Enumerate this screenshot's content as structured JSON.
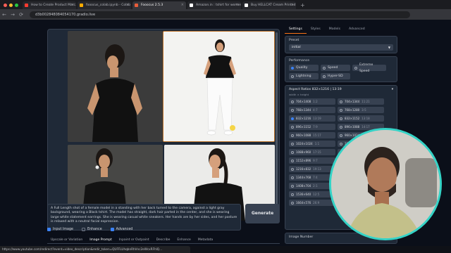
{
  "browser": {
    "tabs": [
      {
        "label": "How to Create Product Marc...",
        "color": "#ff3b30",
        "active": false
      },
      {
        "label": "fooocus_colab.ipynb - Colab",
        "color": "#f9ab00",
        "active": false
      },
      {
        "label": "Fooocus 2.5.3",
        "color": "#e85d3a",
        "active": true
      },
      {
        "label": "Amazon.in : tshirt for women",
        "color": "#ffffff",
        "active": false
      },
      {
        "label": "Buy HELLCAT Cream Printed...",
        "color": "#ffffff",
        "active": false
      }
    ],
    "new_tab": "+",
    "url": "d3b002848084054170.gradio.live",
    "nav": {
      "back": "←",
      "forward": "→",
      "reload": "⟳"
    }
  },
  "prompt": {
    "text": "A Full Length shot of a female model in a standing with her back turned to the camera, against a light gray background, wearing a Black tshirt. The model has straight, dark hair parted in the center, and she is wearing large white statement earrings. She is wearing casual white sneakers. Her hands are by her sides, and her posture is relaxed with a neutral facial expression."
  },
  "generate_label": "Generate",
  "options": {
    "input_image": "Input Image",
    "enhance": "Enhance",
    "advanced": "Advanced"
  },
  "subtabs": [
    "Upscale or Variation",
    "Image Prompt",
    "Inpaint or Outpaint",
    "Describe",
    "Enhance",
    "Metadata"
  ],
  "settings": {
    "tabs": [
      "Settings",
      "Styles",
      "Models",
      "Advanced"
    ],
    "preset_label": "Preset",
    "preset_value": "initial",
    "performance_label": "Performance",
    "performance": [
      "Quality",
      "Speed",
      "Extreme Speed",
      "Lightning",
      "Hyper-SD"
    ],
    "aspect_label": "Aspect Ratios 832×1216 | 13:19",
    "aspect_sub": "width × height",
    "aspect_ratios": [
      {
        "size": "704×1408",
        "ratio": "1:2"
      },
      {
        "size": "704×1344",
        "ratio": "11:21"
      },
      {
        "size": "768×1344",
        "ratio": "4:7"
      },
      {
        "size": "768×1280",
        "ratio": "3:5"
      },
      {
        "size": "832×1216",
        "ratio": "13:19"
      },
      {
        "size": "832×1152",
        "ratio": "13:18"
      },
      {
        "size": "896×1152",
        "ratio": "7:9"
      },
      {
        "size": "896×1088",
        "ratio": "14:17"
      },
      {
        "size": "960×1088",
        "ratio": "15:17"
      },
      {
        "size": "960×1024",
        "ratio": "15:16"
      },
      {
        "size": "1024×1024",
        "ratio": "1:1"
      },
      {
        "size": "1024×960",
        "ratio": "16:15"
      },
      {
        "size": "1088×960",
        "ratio": "17:15"
      },
      {
        "size": "1088×896",
        "ratio": "17:14"
      },
      {
        "size": "1152×896",
        "ratio": "9:7"
      },
      {
        "size": "1152×832",
        "ratio": "18:13"
      },
      {
        "size": "1216×832",
        "ratio": "19:13"
      },
      {
        "size": "1280×768",
        "ratio": "5:3"
      },
      {
        "size": "1344×768",
        "ratio": "7:4"
      },
      {
        "size": "1344×704",
        "ratio": "21:11"
      },
      {
        "size": "1408×704",
        "ratio": "2:1"
      },
      {
        "size": "1472×704",
        "ratio": "23:11"
      },
      {
        "size": "1536×640",
        "ratio": "12:5"
      },
      {
        "size": "1600×640",
        "ratio": "5:2"
      },
      {
        "size": "1664×576",
        "ratio": "26:9"
      },
      {
        "size": "1728×576",
        "ratio": "3:1"
      }
    ],
    "image_number_label": "Image Number"
  },
  "status_url": "https://www.youtube.com/redirect?event=video_description&redir_token=QUFFLUhqbnRhVnc2eWcxRFhlQ..."
}
